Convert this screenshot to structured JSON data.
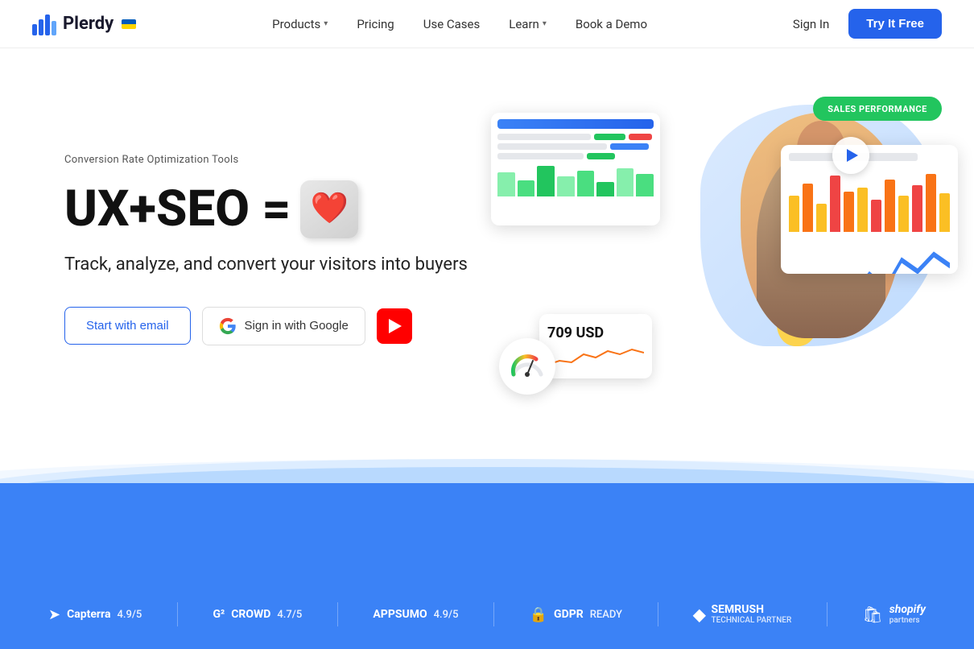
{
  "header": {
    "logo_text": "Plerdy",
    "nav_items": [
      {
        "label": "Products",
        "has_dropdown": true
      },
      {
        "label": "Pricing",
        "has_dropdown": false
      },
      {
        "label": "Use Cases",
        "has_dropdown": false
      },
      {
        "label": "Learn",
        "has_dropdown": true
      },
      {
        "label": "Book a Demo",
        "has_dropdown": false
      }
    ],
    "sign_in_label": "Sign In",
    "try_free_label": "Try It Free"
  },
  "hero": {
    "subtitle": "Conversion Rate Optimization Tools",
    "headline_text": "UX+SEO =",
    "heart_emoji": "❤️",
    "tagline": "Track, analyze, and convert your visitors into buyers",
    "email_btn_label": "Start with email",
    "google_btn_label": "Sign in with Google",
    "sales_badge": "SALES PERFORMANCE",
    "price_amount": "709 USD"
  },
  "partners": [
    {
      "icon": "➤",
      "name": "Capterra",
      "score": "4.9/5"
    },
    {
      "icon": "G²",
      "name": "CROWD",
      "score": "4.7/5"
    },
    {
      "icon": "■",
      "name": "APPSUMO",
      "score": "4.9/5"
    },
    {
      "icon": "🔒",
      "name": "GDPR",
      "label": "READY"
    },
    {
      "icon": "◆",
      "name": "SEMRUSH",
      "label": "TECHNICAL PARTNER"
    },
    {
      "icon": "◈",
      "name": "shopify",
      "label": "partners"
    }
  ],
  "colors": {
    "primary_blue": "#2563eb",
    "light_blue": "#3b82f6",
    "green": "#22c55e",
    "red": "#ef4444",
    "yellow": "#FCD34D"
  }
}
